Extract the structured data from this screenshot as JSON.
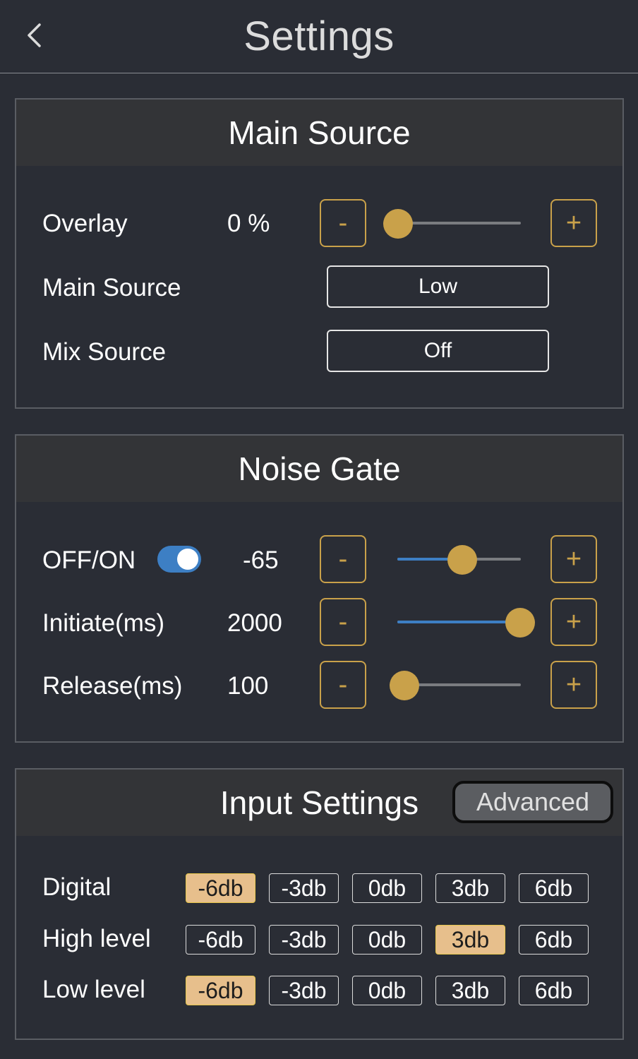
{
  "header": {
    "title": "Settings"
  },
  "main_source": {
    "title": "Main Source",
    "overlay": {
      "label": "Overlay",
      "value": "0 %",
      "level": 0.0,
      "minus": "-",
      "plus": "+"
    },
    "main_source": {
      "label": "Main Source",
      "value": "Low"
    },
    "mix_source": {
      "label": "Mix Source",
      "value": "Off"
    }
  },
  "noise_gate": {
    "title": "Noise Gate",
    "onoff": {
      "label": "OFF/ON",
      "enabled": true,
      "value": "-65",
      "level": 0.6,
      "minus": "-",
      "plus": "+"
    },
    "initiate": {
      "label": "Initiate(ms)",
      "value": "2000",
      "level": 1.0,
      "minus": "-",
      "plus": "+"
    },
    "release": {
      "label": "Release(ms)",
      "value": "100",
      "level": 0.0,
      "minus": "-",
      "plus": "+"
    }
  },
  "input_settings": {
    "title": "Input Settings",
    "advanced_label": "Advanced",
    "options": [
      "-6db",
      "-3db",
      "0db",
      "3db",
      "6db"
    ],
    "rows": [
      {
        "label": "Digital",
        "selected": "-6db"
      },
      {
        "label": "High level",
        "selected": "3db"
      },
      {
        "label": "Low level",
        "selected": "-6db"
      }
    ]
  },
  "colors": {
    "accent": "#c9a14a",
    "toggle_on": "#3d7fc4",
    "selected_bg": "#e7bf8c",
    "background": "#2a2d35"
  }
}
